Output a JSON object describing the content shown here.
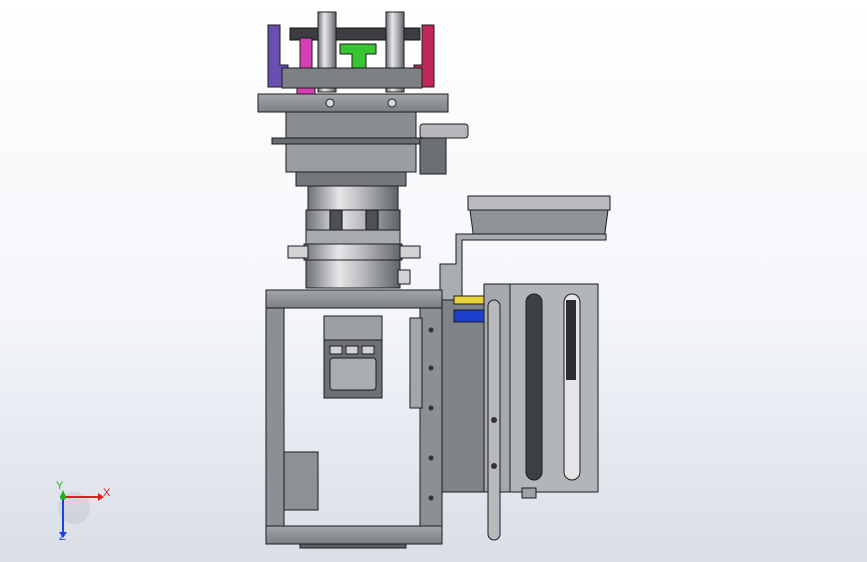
{
  "viewport": {
    "background_top": "#ffffff",
    "background_bottom": "#d9dee7"
  },
  "model": {
    "colors": {
      "metal": "#8f9297",
      "metal_light": "#c9cbce",
      "metal_dark": "#55585c",
      "edge": "#1c1c1c",
      "purple_part": "#6a4fb3",
      "magenta_part": "#d63fb4",
      "crimson_part": "#c0285b",
      "green_part": "#39c431",
      "yellow_strip": "#e8d43a",
      "blue_strip": "#1d3fcf"
    }
  },
  "triad": {
    "x_label": "X",
    "y_label": "Y",
    "z_label": "Z",
    "x_color": "#e02020",
    "y_color": "#20b020",
    "z_color": "#2040e0"
  }
}
